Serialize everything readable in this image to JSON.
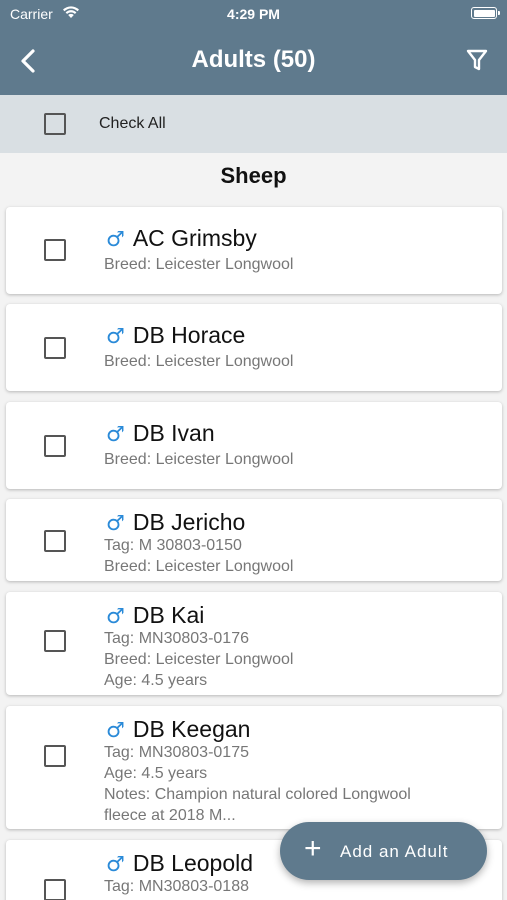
{
  "status_bar": {
    "carrier": "Carrier",
    "time": "4:29 PM",
    "wifi_icon": "wifi-icon",
    "battery_icon": "battery-icon"
  },
  "nav": {
    "title": "Adults (50)",
    "back_icon": "back-chevron-icon",
    "filter_icon": "filter-icon"
  },
  "check_all": {
    "label": "Check All"
  },
  "section": {
    "title": "Sheep"
  },
  "male_symbol": "♂",
  "animals": [
    {
      "name": "AC Grimsby",
      "lines": [
        "Breed: Leicester Longwool"
      ]
    },
    {
      "name": "DB Horace",
      "lines": [
        "Breed: Leicester Longwool"
      ]
    },
    {
      "name": "DB Ivan",
      "lines": [
        "Breed: Leicester Longwool"
      ]
    },
    {
      "name": "DB Jericho",
      "lines": [
        "Tag: M 30803-0150",
        "Breed: Leicester Longwool"
      ]
    },
    {
      "name": "DB Kai",
      "lines": [
        "Tag: MN30803-0176",
        "Breed: Leicester Longwool",
        "Age: 4.5 years"
      ]
    },
    {
      "name": "DB Keegan",
      "lines": [
        "Tag: MN30803-0175",
        "Age: 4.5 years",
        "Notes: Champion natural colored Longwool",
        "fleece at 2018 M..."
      ]
    },
    {
      "name": "DB Leopold",
      "lines": [
        "Tag: MN30803-0188"
      ]
    }
  ],
  "fab": {
    "label": "Add an Adult",
    "icon": "plus-icon"
  },
  "colors": {
    "header": "#5f7a8d",
    "check_all_bar": "#d9dfe3",
    "male_icon": "#2a8ad8"
  }
}
